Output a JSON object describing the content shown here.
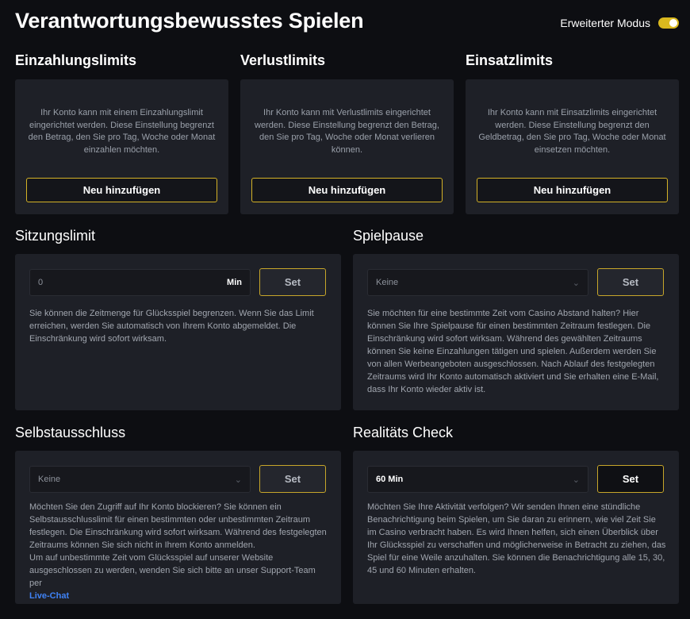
{
  "header": {
    "title": "Verantwortungsbewusstes Spielen",
    "mode_label": "Erweiterter Modus",
    "mode_on": true
  },
  "limits": [
    {
      "title": "Einzahlungslimits",
      "description": "Ihr Konto kann mit einem Einzahlungslimit eingerichtet werden. Diese Einstellung begrenzt den Betrag, den Sie pro Tag, Woche oder Monat einzahlen möchten.",
      "button": "Neu hinzufügen"
    },
    {
      "title": "Verlustlimits",
      "description": "Ihr Konto kann mit Verlustlimits eingerichtet werden. Diese Einstellung begrenzt den Betrag, den Sie pro Tag, Woche oder Monat verlieren können.",
      "button": "Neu hinzufügen"
    },
    {
      "title": "Einsatzlimits",
      "description": "Ihr Konto kann mit Einsatzlimits eingerichtet werden. Diese Einstellung begrenzt den Geldbetrag, den Sie pro Tag, Woche oder Monat einsetzen möchten.",
      "button": "Neu hinzufügen"
    }
  ],
  "session_limit": {
    "title": "Sitzungslimit",
    "input_value": "0",
    "unit": "Min",
    "set_label": "Set",
    "description": "Sie können die Zeitmenge für Glücksspiel begrenzen. Wenn Sie das Limit erreichen, werden Sie automatisch von Ihrem Konto abgemeldet. Die Einschränkung wird sofort wirksam."
  },
  "game_break": {
    "title": "Spielpause",
    "select_value": "Keine",
    "set_label": "Set",
    "description": "Sie möchten für eine bestimmte Zeit vom Casino Abstand halten? Hier können Sie Ihre Spielpause für einen bestimmten Zeitraum festlegen. Die Einschränkung wird sofort wirksam. Während des gewählten Zeitraums können Sie keine Einzahlungen tätigen und spielen. Außerdem werden Sie von allen Werbeangeboten ausgeschlossen. Nach Ablauf des festgelegten Zeitraums wird Ihr Konto automatisch aktiviert und Sie erhalten eine E-Mail, dass Ihr Konto wieder aktiv ist."
  },
  "self_exclusion": {
    "title": "Selbstausschluss",
    "select_value": "Keine",
    "set_label": "Set",
    "description": "Möchten Sie den Zugriff auf Ihr Konto blockieren? Sie können ein Selbstausschlusslimit für einen bestimmten oder unbestimmten Zeitraum festlegen. Die Einschränkung wird sofort wirksam. Während des festgelegten Zeitraums können Sie sich nicht in Ihrem Konto anmelden.",
    "description2": "Um auf unbestimmte Zeit vom Glücksspiel auf unserer Website ausgeschlossen zu werden, wenden Sie sich bitte an unser Support-Team per",
    "link": "Live-Chat"
  },
  "reality_check": {
    "title": "Realitäts Check",
    "select_value": "60 Min",
    "set_label": "Set",
    "description": "Möchten Sie Ihre Aktivität verfolgen? Wir senden Ihnen eine stündliche Benachrichtigung beim Spielen, um Sie daran zu erinnern, wie viel Zeit Sie im Casino verbracht haben. Es wird Ihnen helfen, sich einen Überblick über Ihr Glücksspiel zu verschaffen und möglicherweise in Betracht zu ziehen, das Spiel für eine Weile anzuhalten. Sie können die Benachrichtigung alle 15, 30, 45 und 60 Minuten erhalten."
  },
  "icons": {
    "chevron": "chevron-down-icon"
  },
  "colors": {
    "accent": "#d4b227",
    "card": "#1e2027",
    "background": "#0d0e12",
    "link": "#3f82f5"
  }
}
